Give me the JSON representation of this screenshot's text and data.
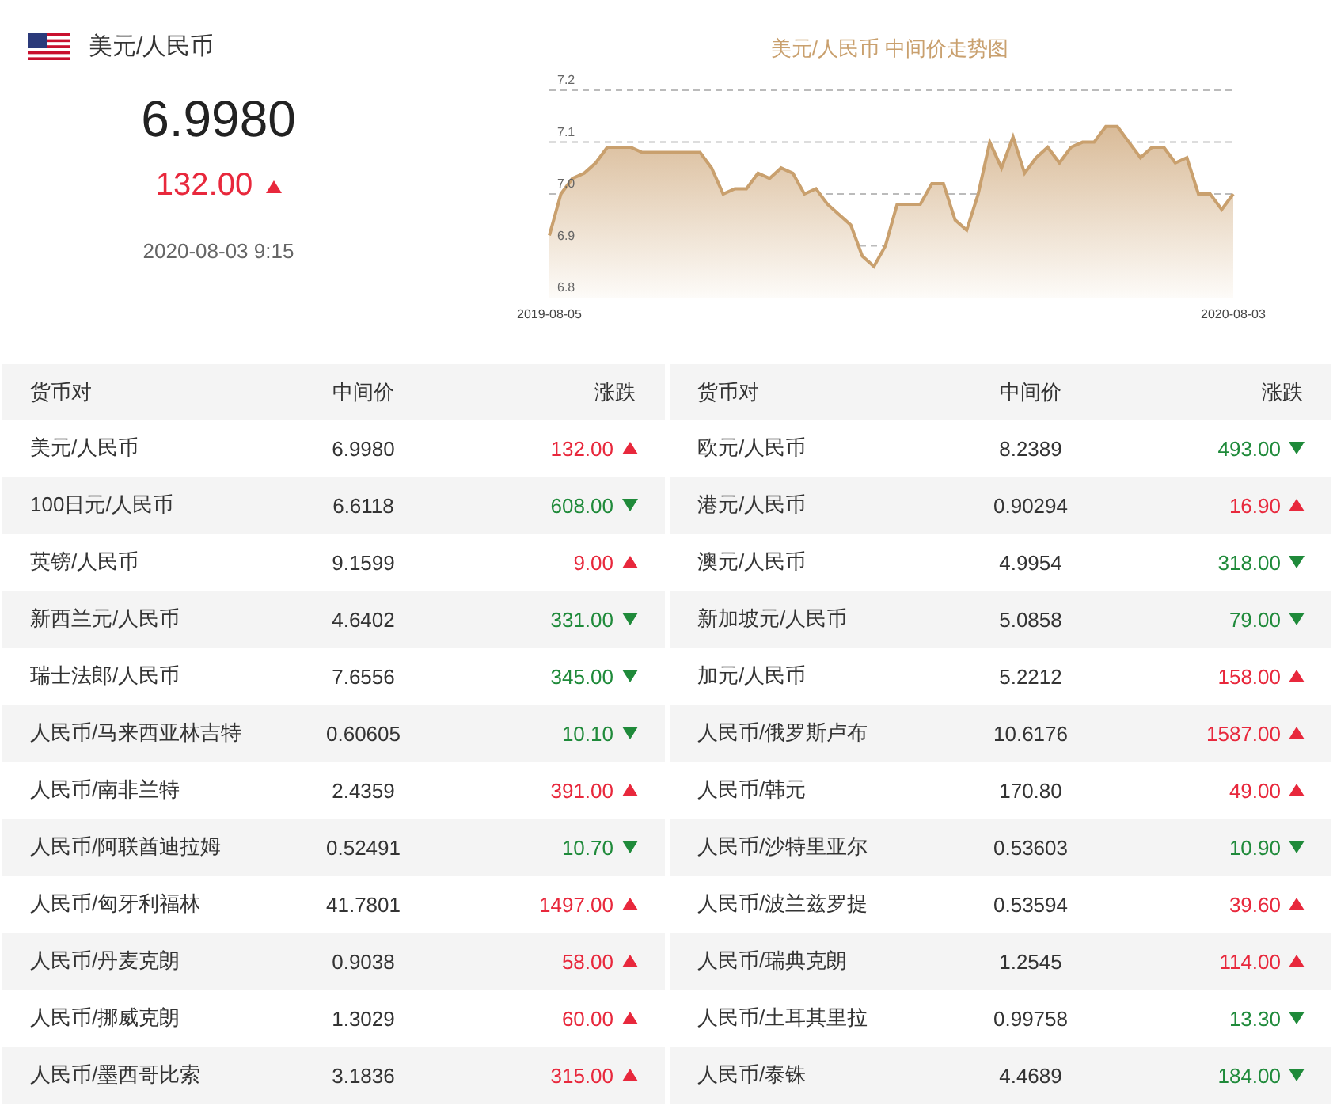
{
  "summary": {
    "pair": "美元/人民币",
    "price": "6.9980",
    "change": "132.00",
    "rising": true,
    "time": "2020-08-03 9:15"
  },
  "trend": {
    "start_date": "2019-08-05",
    "end_date": "2020-08-03",
    "chart_data": {
      "type": "area",
      "title": "美元/人民币 中间价走势图",
      "grid": true,
      "series": [
        {
          "color": "#c9a06e",
          "values": [
            6.92,
            7.0,
            7.03,
            7.04,
            7.06,
            7.09,
            7.09,
            7.09,
            7.08,
            7.08,
            7.08,
            7.08,
            7.08,
            7.08,
            7.05,
            7.0,
            7.01,
            7.01,
            7.04,
            7.03,
            7.05,
            7.04,
            7.0,
            7.01,
            6.98,
            6.96,
            6.94,
            6.88,
            6.86,
            6.9,
            6.98,
            6.98,
            6.98,
            7.02,
            7.02,
            6.95,
            6.93,
            7.0,
            7.1,
            7.05,
            7.11,
            7.04,
            7.07,
            7.09,
            7.06,
            7.09,
            7.1,
            7.1,
            7.13,
            7.13,
            7.1,
            7.07,
            7.09,
            7.09,
            7.06,
            7.07,
            7.0,
            7.0,
            6.97,
            7.0
          ]
        }
      ],
      "ylim": [
        6.8,
        7.2
      ],
      "yticks": [
        {
          "value": 7.2,
          "label": "7.2"
        },
        {
          "value": 7.1,
          "label": "7.1"
        },
        {
          "value": 7.0,
          "label": "7.0"
        },
        {
          "value": 6.9,
          "label": "6.9"
        },
        {
          "value": 6.8,
          "label": "6.8"
        }
      ]
    }
  },
  "tables": [
    {
      "columns": [
        "货币对",
        "中间价",
        "涨跌"
      ],
      "rows": [
        {
          "pair": "美元/人民币",
          "mid": "6.9980",
          "change": "132.00",
          "rising": true
        },
        {
          "pair": "100日元/人民币",
          "mid": "6.6118",
          "change": "608.00",
          "rising": false
        },
        {
          "pair": "英镑/人民币",
          "mid": "9.1599",
          "change": "9.00",
          "rising": true
        },
        {
          "pair": "新西兰元/人民币",
          "mid": "4.6402",
          "change": "331.00",
          "rising": false
        },
        {
          "pair": "瑞士法郎/人民币",
          "mid": "7.6556",
          "change": "345.00",
          "rising": false
        },
        {
          "pair": "人民币/马来西亚林吉特",
          "mid": "0.60605",
          "change": "10.10",
          "rising": false
        },
        {
          "pair": "人民币/南非兰特",
          "mid": "2.4359",
          "change": "391.00",
          "rising": true
        },
        {
          "pair": "人民币/阿联酋迪拉姆",
          "mid": "0.52491",
          "change": "10.70",
          "rising": false
        },
        {
          "pair": "人民币/匈牙利福林",
          "mid": "41.7801",
          "change": "1497.00",
          "rising": true
        },
        {
          "pair": "人民币/丹麦克朗",
          "mid": "0.9038",
          "change": "58.00",
          "rising": true
        },
        {
          "pair": "人民币/挪威克朗",
          "mid": "1.3029",
          "change": "60.00",
          "rising": true
        },
        {
          "pair": "人民币/墨西哥比索",
          "mid": "3.1836",
          "change": "315.00",
          "rising": true
        }
      ]
    },
    {
      "columns": [
        "货币对",
        "中间价",
        "涨跌"
      ],
      "rows": [
        {
          "pair": "欧元/人民币",
          "mid": "8.2389",
          "change": "493.00",
          "rising": false
        },
        {
          "pair": "港元/人民币",
          "mid": "0.90294",
          "change": "16.90",
          "rising": true
        },
        {
          "pair": "澳元/人民币",
          "mid": "4.9954",
          "change": "318.00",
          "rising": false
        },
        {
          "pair": "新加坡元/人民币",
          "mid": "5.0858",
          "change": "79.00",
          "rising": false
        },
        {
          "pair": "加元/人民币",
          "mid": "5.2212",
          "change": "158.00",
          "rising": true
        },
        {
          "pair": "人民币/俄罗斯卢布",
          "mid": "10.6176",
          "change": "1587.00",
          "rising": true
        },
        {
          "pair": "人民币/韩元",
          "mid": "170.80",
          "change": "49.00",
          "rising": true
        },
        {
          "pair": "人民币/沙特里亚尔",
          "mid": "0.53603",
          "change": "10.90",
          "rising": false
        },
        {
          "pair": "人民币/波兰兹罗提",
          "mid": "0.53594",
          "change": "39.60",
          "rising": true
        },
        {
          "pair": "人民币/瑞典克朗",
          "mid": "1.2545",
          "change": "114.00",
          "rising": true
        },
        {
          "pair": "人民币/土耳其里拉",
          "mid": "0.99758",
          "change": "13.30",
          "rising": false
        },
        {
          "pair": "人民币/泰铢",
          "mid": "4.4689",
          "change": "184.00",
          "rising": false
        }
      ]
    }
  ]
}
